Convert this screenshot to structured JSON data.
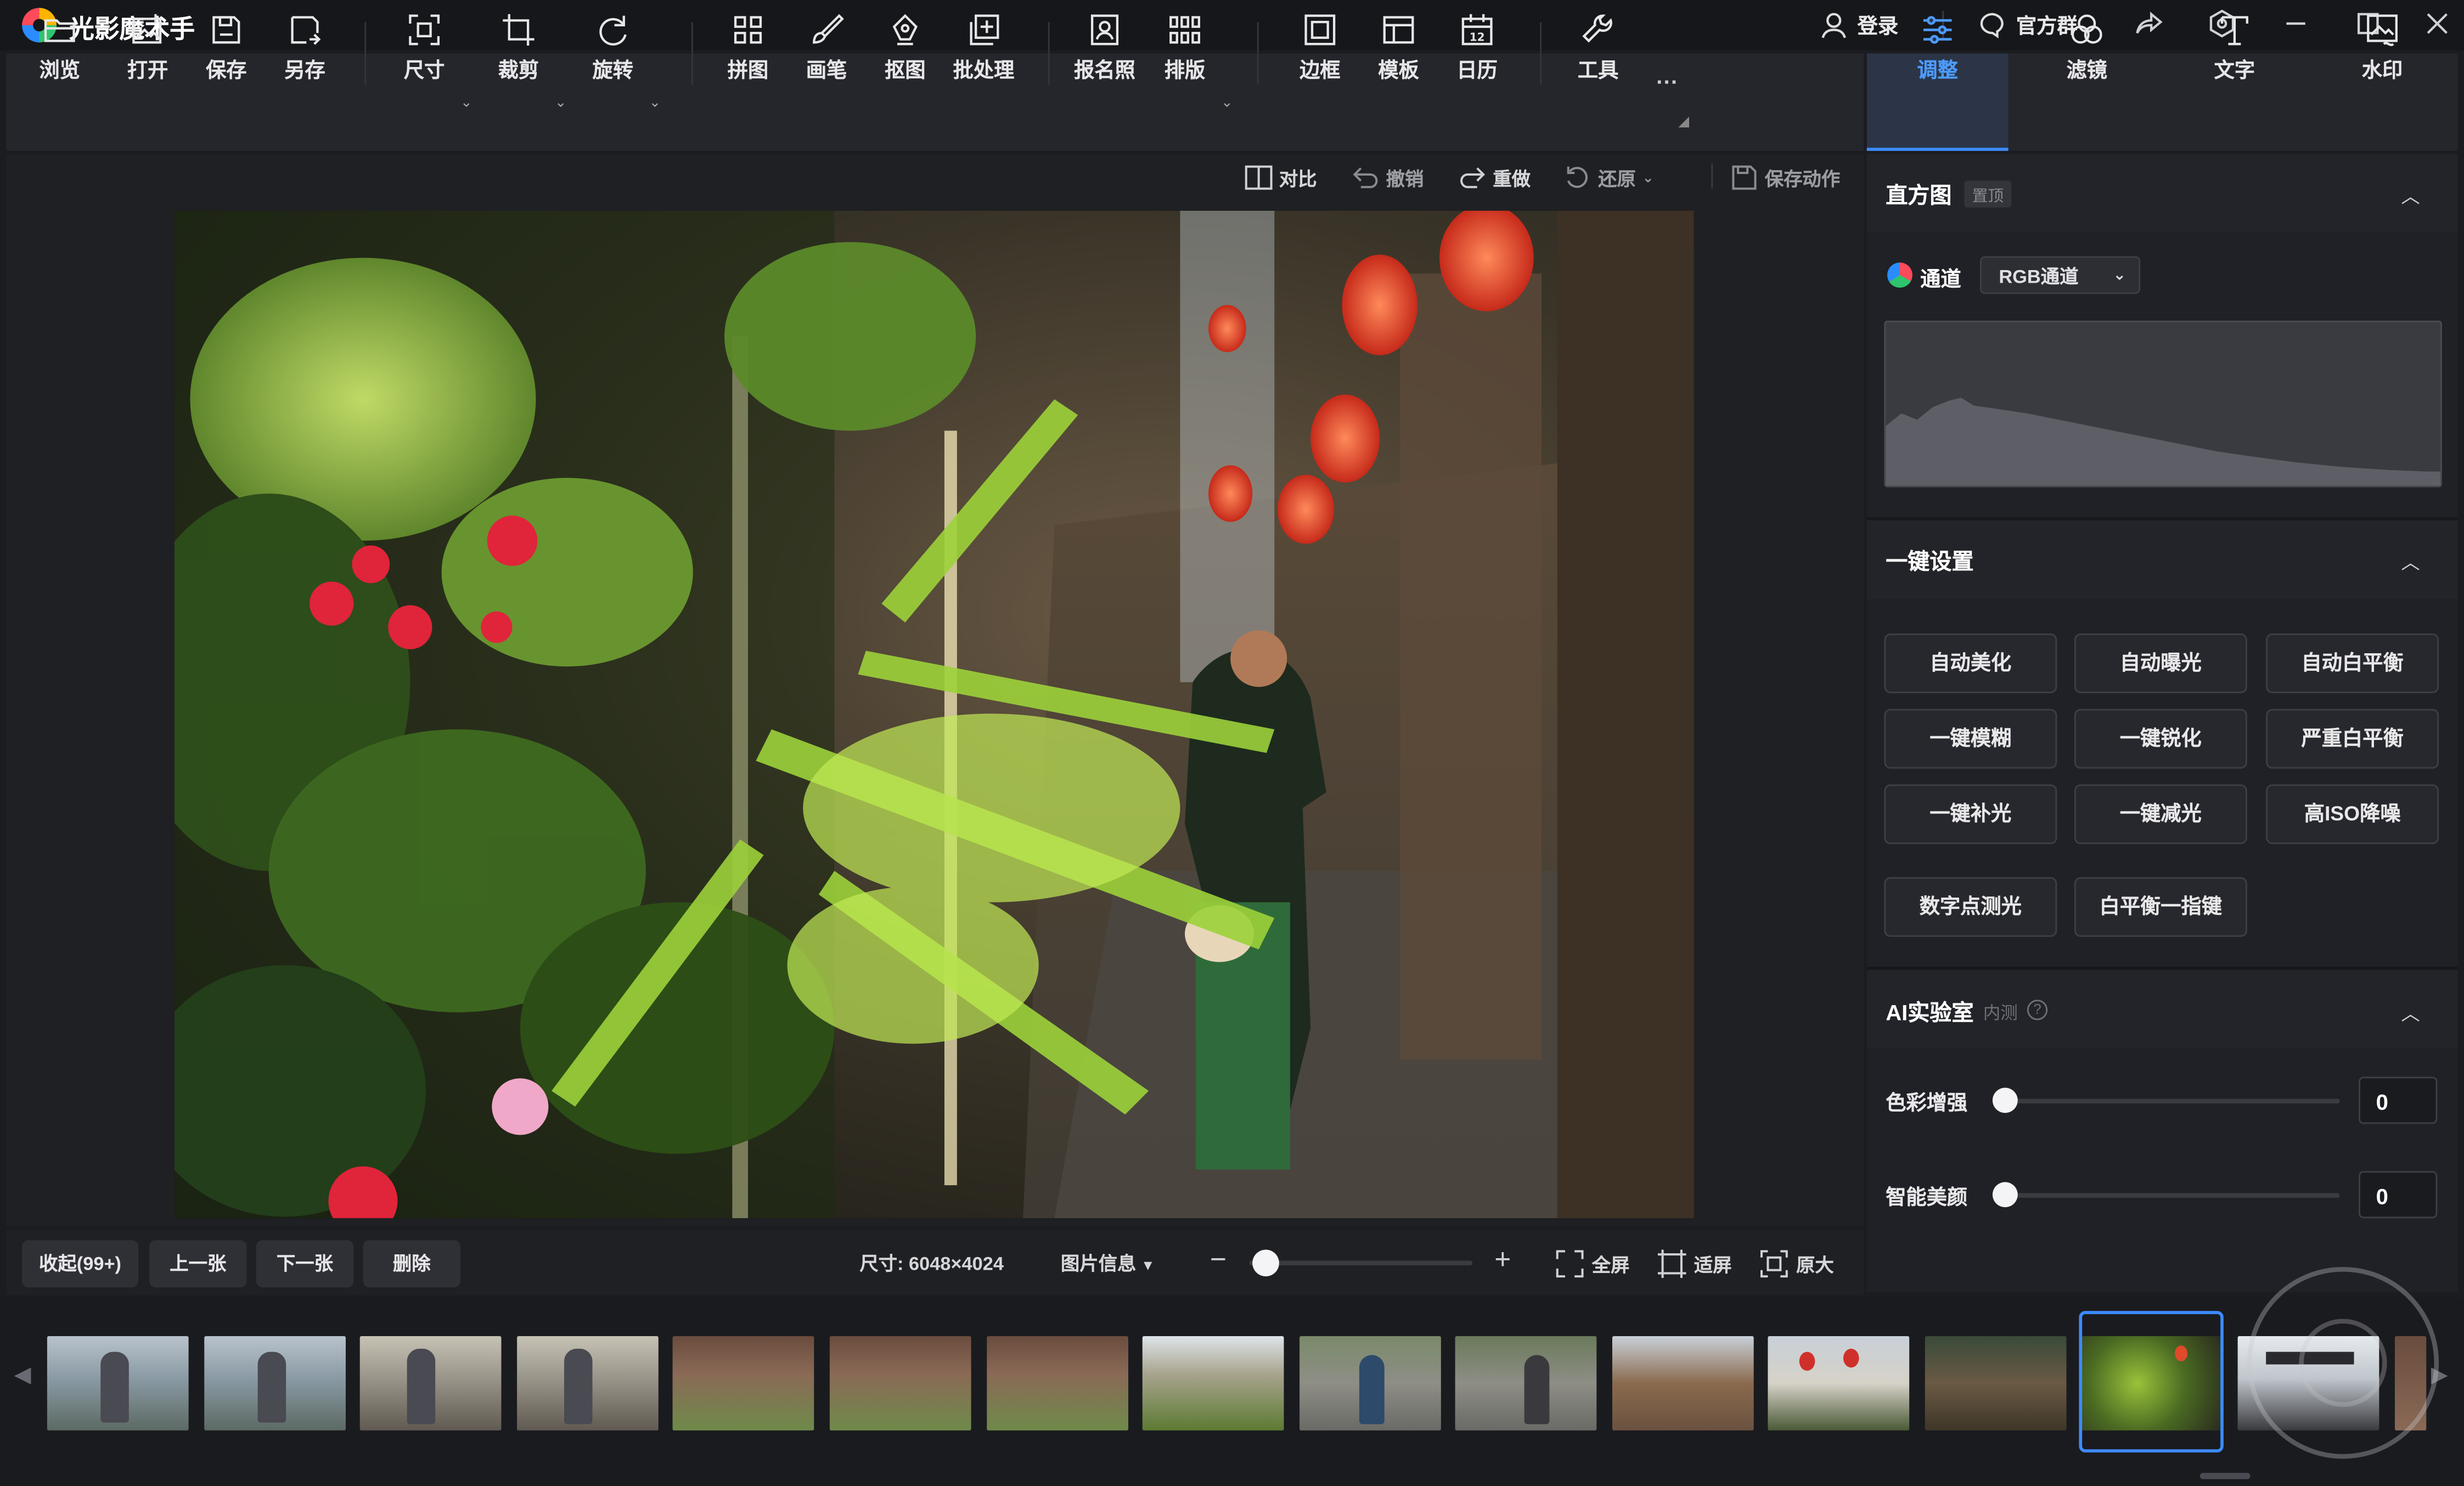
{
  "app": {
    "title": "光影魔术手"
  },
  "titlebar": {
    "login": "登录",
    "group": "官方群"
  },
  "toolbar": {
    "browse": "浏览",
    "open": "打开",
    "save": "保存",
    "saveas": "另存",
    "size": "尺寸",
    "crop": "裁剪",
    "rotate": "旋转",
    "collage": "拼图",
    "brush": "画笔",
    "cutout": "抠图",
    "batch": "批处理",
    "idphoto": "报名照",
    "layout": "排版",
    "border": "边框",
    "template": "模板",
    "calendar": "日历",
    "tools": "工具",
    "more": "···"
  },
  "right_tabs": {
    "adjust": "调整",
    "filter": "滤镜",
    "text": "文字",
    "watermark": "水印"
  },
  "edit_actions": {
    "compare": "对比",
    "undo": "撤销",
    "redo": "重做",
    "restore": "还原",
    "save_action": "保存动作"
  },
  "bottom": {
    "collapse": "收起(99+)",
    "prev": "上一张",
    "next": "下一张",
    "delete": "删除",
    "size_info": "尺寸: 6048×4024",
    "photo_info": "图片信息",
    "zoom_out": "−",
    "zoom_in": "+",
    "fullscreen": "全屏",
    "fit": "适屏",
    "original": "原大"
  },
  "panel": {
    "histogram": {
      "title": "直方图",
      "badge": "置顶",
      "channel_label": "通道",
      "channel_value": "RGB通道"
    },
    "oneclick": {
      "title": "一键设置",
      "buttons": [
        "自动美化",
        "自动曝光",
        "自动白平衡",
        "一键模糊",
        "一键锐化",
        "严重白平衡",
        "一键补光",
        "一键减光",
        "高ISO降噪",
        "数字点测光",
        "白平衡一指键"
      ]
    },
    "ai": {
      "title": "AI实验室",
      "badge": "内测",
      "sliders": [
        {
          "label": "色彩增强",
          "value": "0"
        },
        {
          "label": "智能美颜",
          "value": "0"
        }
      ]
    }
  },
  "colors": {
    "accent": "#3c8bff",
    "background": "#1b1c20",
    "panel": "#202126"
  }
}
